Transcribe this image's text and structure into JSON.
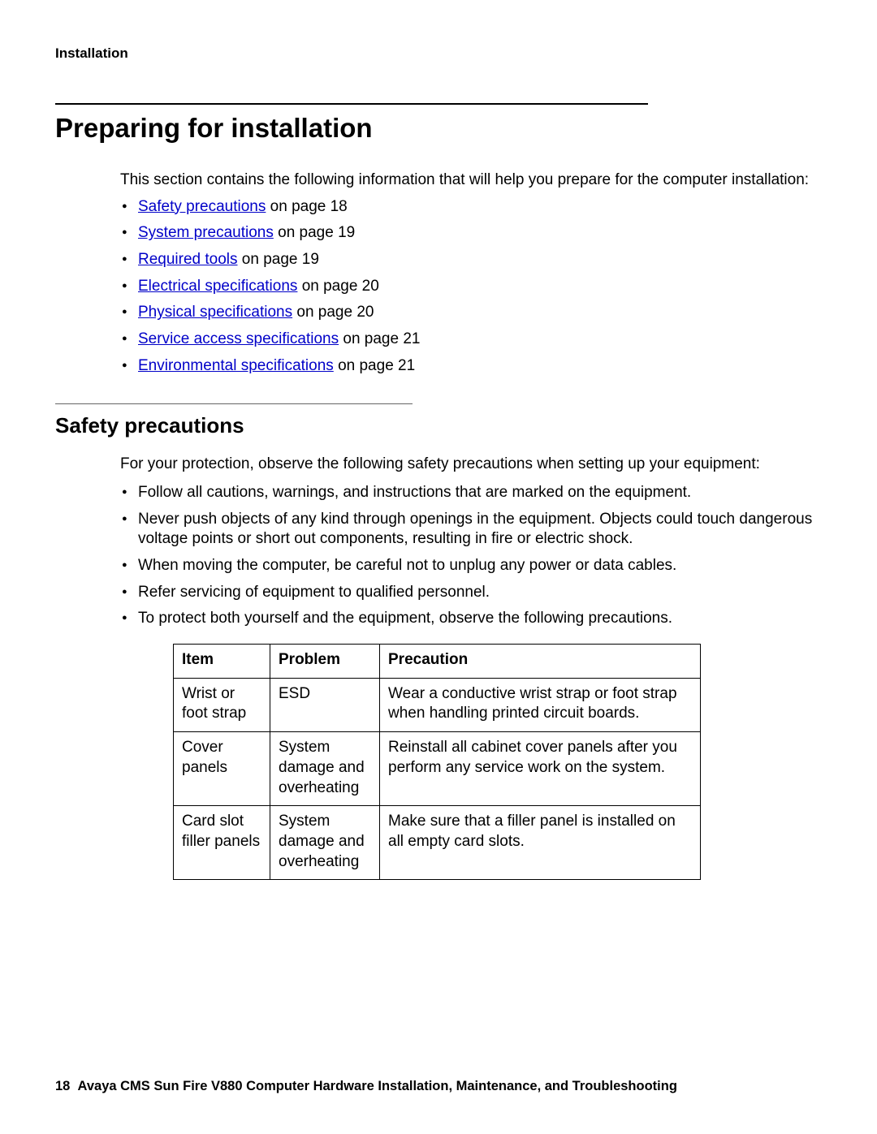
{
  "header": {
    "section_label": "Installation"
  },
  "title": "Preparing for installation",
  "intro": "This section contains the following information that will help you prepare for the computer installation:",
  "toc": [
    {
      "link": "Safety precautions",
      "suffix": " on page 18"
    },
    {
      "link": "System precautions",
      "suffix": " on page 19"
    },
    {
      "link": "Required tools",
      "suffix": " on page 19"
    },
    {
      "link": "Electrical specifications",
      "suffix": " on page 20"
    },
    {
      "link": "Physical specifications",
      "suffix": " on page 20"
    },
    {
      "link": "Service access specifications",
      "suffix": " on page 21"
    },
    {
      "link": "Environmental specifications",
      "suffix": " on page 21"
    }
  ],
  "safety": {
    "heading": "Safety precautions",
    "intro": "For your protection, observe the following safety precautions when setting up your equipment:",
    "items": [
      "Follow all cautions, warnings, and instructions that are marked on the equipment.",
      "Never push objects of any kind through openings in the equipment. Objects could touch dangerous voltage points or short out components, resulting in fire or electric shock.",
      "When moving the computer, be careful not to unplug any power or data cables.",
      "Refer servicing of equipment to qualified personnel.",
      "To protect both yourself and the equipment, observe the following precautions."
    ],
    "table": {
      "headers": {
        "item": "Item",
        "problem": "Problem",
        "precaution": "Precaution"
      },
      "rows": [
        {
          "item": "Wrist or foot strap",
          "problem": "ESD",
          "precaution": "Wear a conductive wrist strap or foot strap when handling printed circuit boards."
        },
        {
          "item": "Cover panels",
          "problem": "System damage and overheating",
          "precaution": "Reinstall all cabinet cover panels after you perform any service work on the system."
        },
        {
          "item": "Card slot filler panels",
          "problem": "System damage and overheating",
          "precaution": "Make sure that a filler panel is installed on all empty card slots."
        }
      ]
    }
  },
  "footer": {
    "page_number": "18",
    "doc_title": "Avaya CMS Sun Fire V880 Computer Hardware Installation, Maintenance, and Troubleshooting"
  }
}
